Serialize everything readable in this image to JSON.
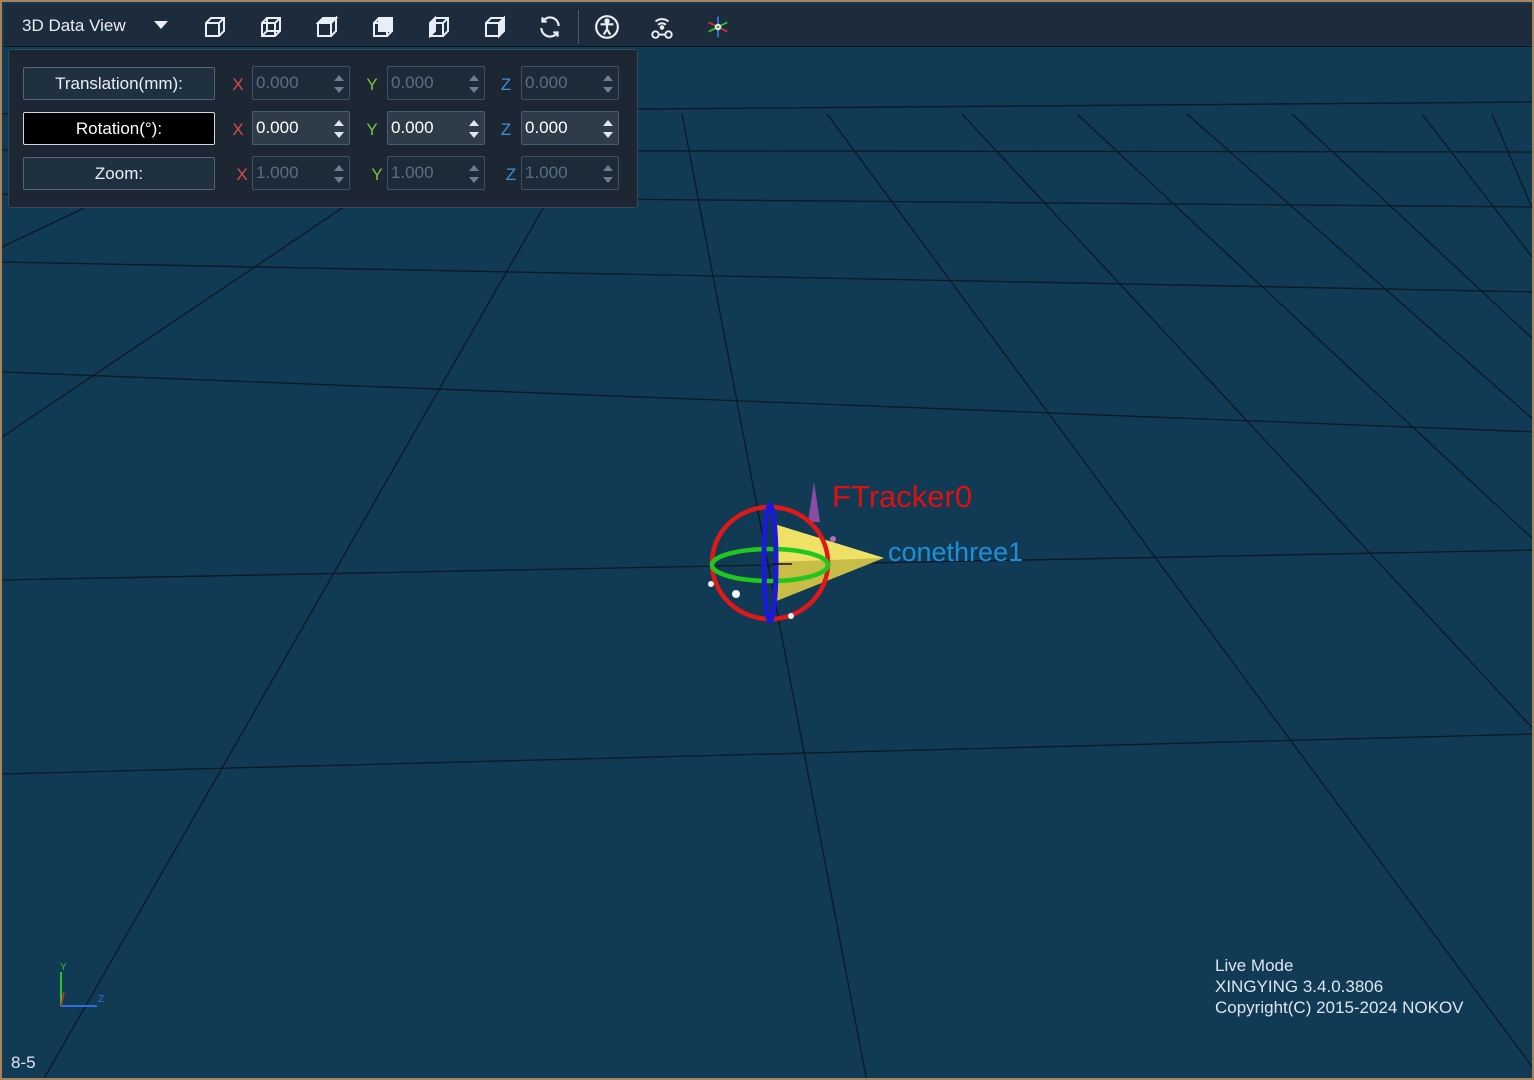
{
  "toolbar": {
    "view_title": "3D Data View",
    "buttons": [
      {
        "icon": "view-perspective-icon"
      },
      {
        "icon": "view-front-icon"
      },
      {
        "icon": "view-top-icon"
      },
      {
        "icon": "view-side-icon"
      },
      {
        "icon": "view-left-icon"
      },
      {
        "icon": "view-right-icon"
      },
      {
        "icon": "refresh-icon"
      },
      {
        "icon": "skeleton-icon"
      },
      {
        "icon": "wireless-device-icon"
      },
      {
        "icon": "axes-icon"
      }
    ]
  },
  "transform_panel": {
    "axes": {
      "x": "X",
      "y": "Y",
      "z": "Z"
    },
    "translation": {
      "label": "Translation(mm):",
      "x": "0.000",
      "y": "0.000",
      "z": "0.000",
      "enabled": false
    },
    "rotation": {
      "label": "Rotation(°):",
      "x": "0.000",
      "y": "0.000",
      "z": "0.000",
      "enabled": true
    },
    "zoom": {
      "label": "Zoom:",
      "x": "1.000",
      "y": "1.000",
      "z": "1.000",
      "enabled": false
    }
  },
  "scene": {
    "tracker_label": "FTracker0",
    "rigid_body_label": "conethree1",
    "gizmo_axis_label": {
      "x": "X",
      "y": "Y",
      "z": "Z"
    }
  },
  "status": {
    "mode": "Live Mode",
    "version": "XINGYING 3.4.0.3806",
    "copyright": "Copyright(C) 2015-2024 NOKOV"
  },
  "corner_label": "8-5",
  "colors": {
    "background": "#113a55",
    "tracker_label": "#e01010",
    "rigid_body_label": "#1e8fd6",
    "frame_border": "#a9835a"
  }
}
